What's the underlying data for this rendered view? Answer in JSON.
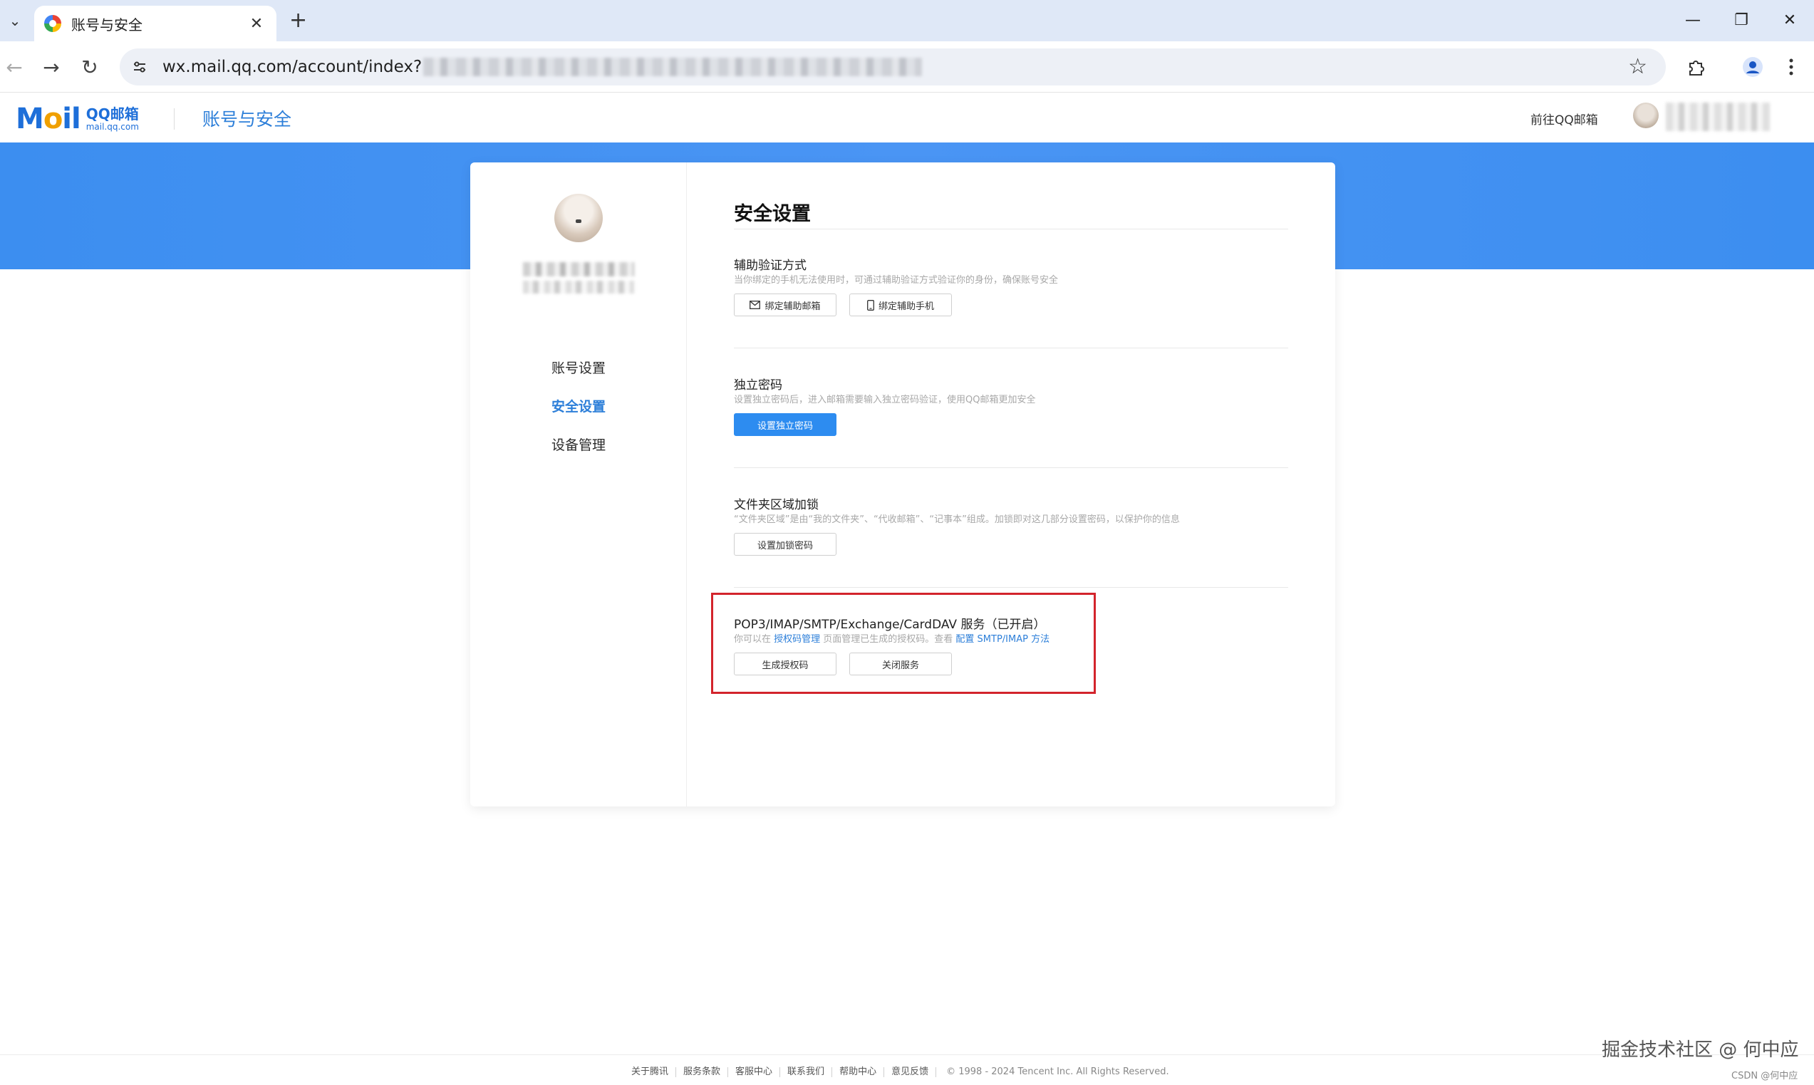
{
  "browser": {
    "tab_title": "账号与安全",
    "url_visible": "wx.mail.qq.com/account/index?"
  },
  "header": {
    "logo_mark": "Mail",
    "logo_cn": "QQ邮箱",
    "logo_en": "mail.qq.com",
    "title": "账号与安全",
    "goto_mail": "前往QQ邮箱"
  },
  "sidebar": {
    "items": [
      {
        "label": "账号设置",
        "active": false
      },
      {
        "label": "安全设置",
        "active": true
      },
      {
        "label": "设备管理",
        "active": false
      }
    ]
  },
  "content": {
    "title": "安全设置",
    "sections": [
      {
        "title": "辅助验证方式",
        "desc": "当你绑定的手机无法使用时，可通过辅助验证方式验证你的身份，确保账号安全",
        "buttons": [
          "绑定辅助邮箱",
          "绑定辅助手机"
        ]
      },
      {
        "title": "独立密码",
        "desc": "设置独立密码后，进入邮箱需要输入独立密码验证，使用QQ邮箱更加安全",
        "buttons": [
          "设置独立密码"
        ]
      },
      {
        "title": "文件夹区域加锁",
        "desc": "“文件夹区域”是由“我的文件夹”、“代收邮箱”、“记事本”组成。加锁即对这几部分设置密码，以保护你的信息",
        "buttons": [
          "设置加锁密码"
        ]
      },
      {
        "title": "POP3/IMAP/SMTP/Exchange/CardDAV 服务（已开启）",
        "desc_parts": {
          "p1": "你可以在 ",
          "link1": "授权码管理",
          "p2": " 页面管理已生成的授权码。查看 ",
          "link2": "配置 SMTP/IMAP 方法"
        },
        "buttons": [
          "生成授权码",
          "关闭服务"
        ]
      }
    ]
  },
  "footer": {
    "links": [
      "关于腾讯",
      "服务条款",
      "客服中心",
      "联系我们",
      "帮助中心",
      "意见反馈"
    ],
    "copyright": "© 1998 - 2024 Tencent Inc. All Rights Reserved."
  },
  "watermark": "掘金技术社区 @ 何中应",
  "csdn_mark": "CSDN @何中应",
  "colors": {
    "accent": "#2d7fd9",
    "primary_button": "#2d8cf0",
    "banner": "#3c8ef0",
    "highlight_box": "#d3242c"
  }
}
